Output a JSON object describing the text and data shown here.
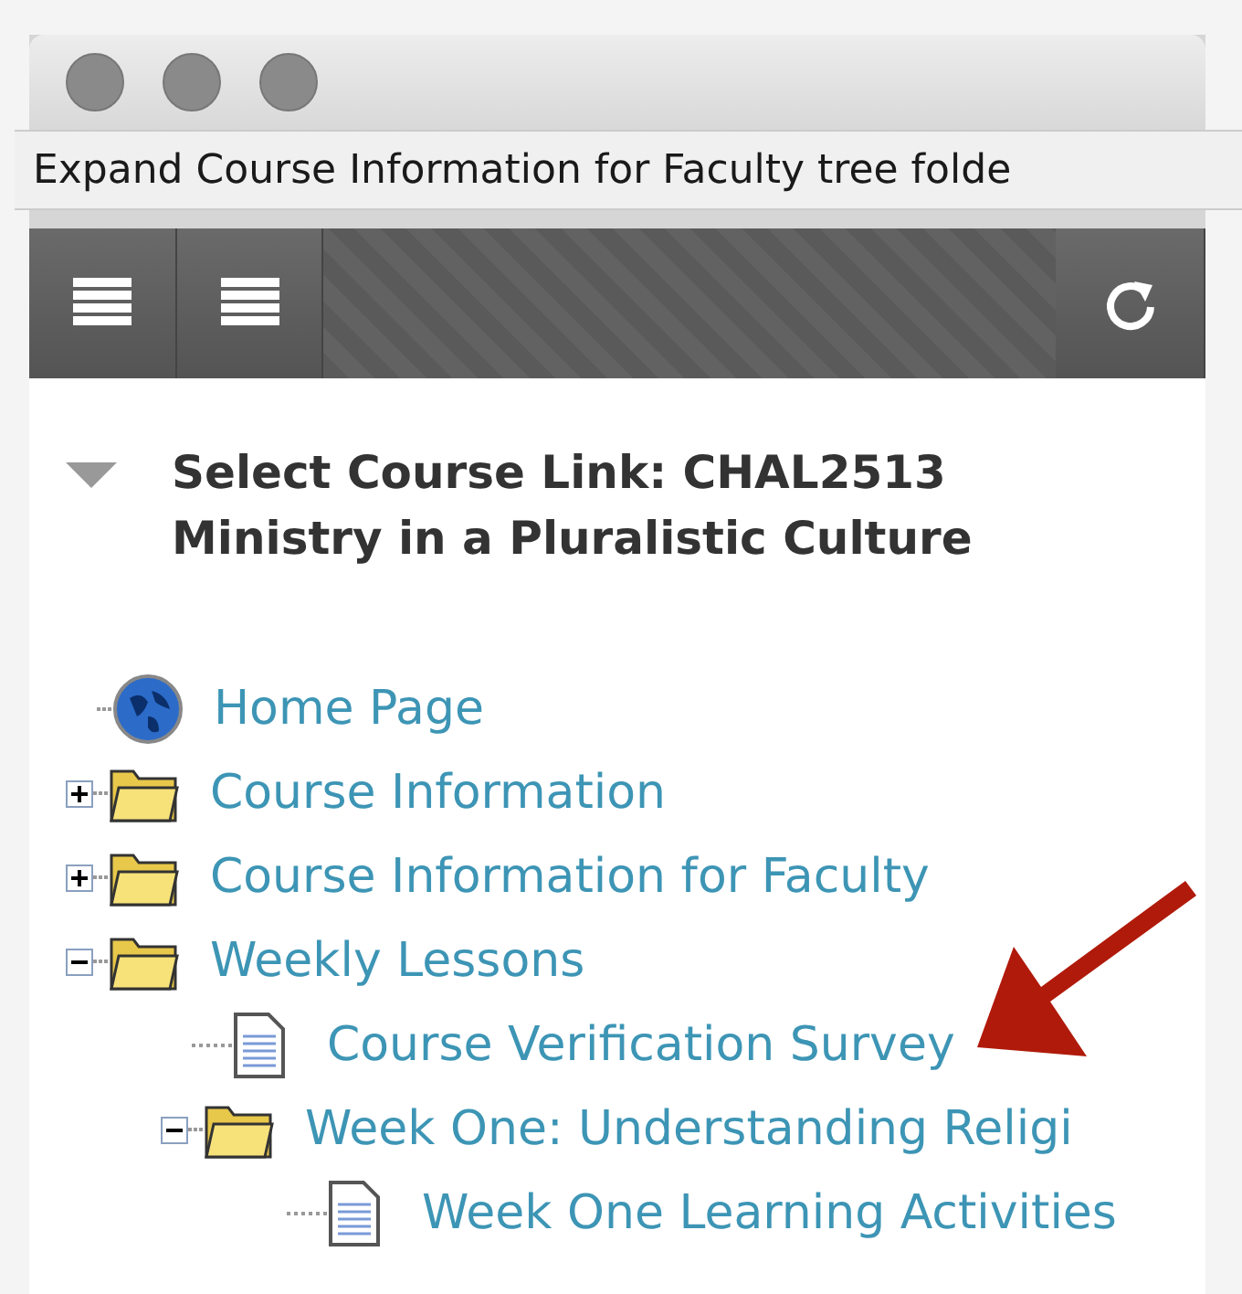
{
  "window": {
    "tooltip": "Expand Course Information for Faculty tree folde"
  },
  "panel": {
    "expanded": true,
    "title": "Select Course Link: CHAL2513 Ministry in a Pluralistic Culture"
  },
  "tree": [
    {
      "kind": "globe",
      "label": "Home Page"
    },
    {
      "kind": "folder",
      "label": "Course Information",
      "expanded": false
    },
    {
      "kind": "folder",
      "label": "Course Information for Faculty",
      "expanded": false
    },
    {
      "kind": "folder",
      "label": "Weekly Lessons",
      "expanded": true,
      "children": [
        {
          "kind": "document",
          "label": "Course Verification Survey"
        },
        {
          "kind": "folder",
          "label": "Week One: Understanding Religi",
          "expanded": true,
          "children": [
            {
              "kind": "document",
              "label": "Week One Learning Activities"
            }
          ]
        }
      ]
    }
  ]
}
